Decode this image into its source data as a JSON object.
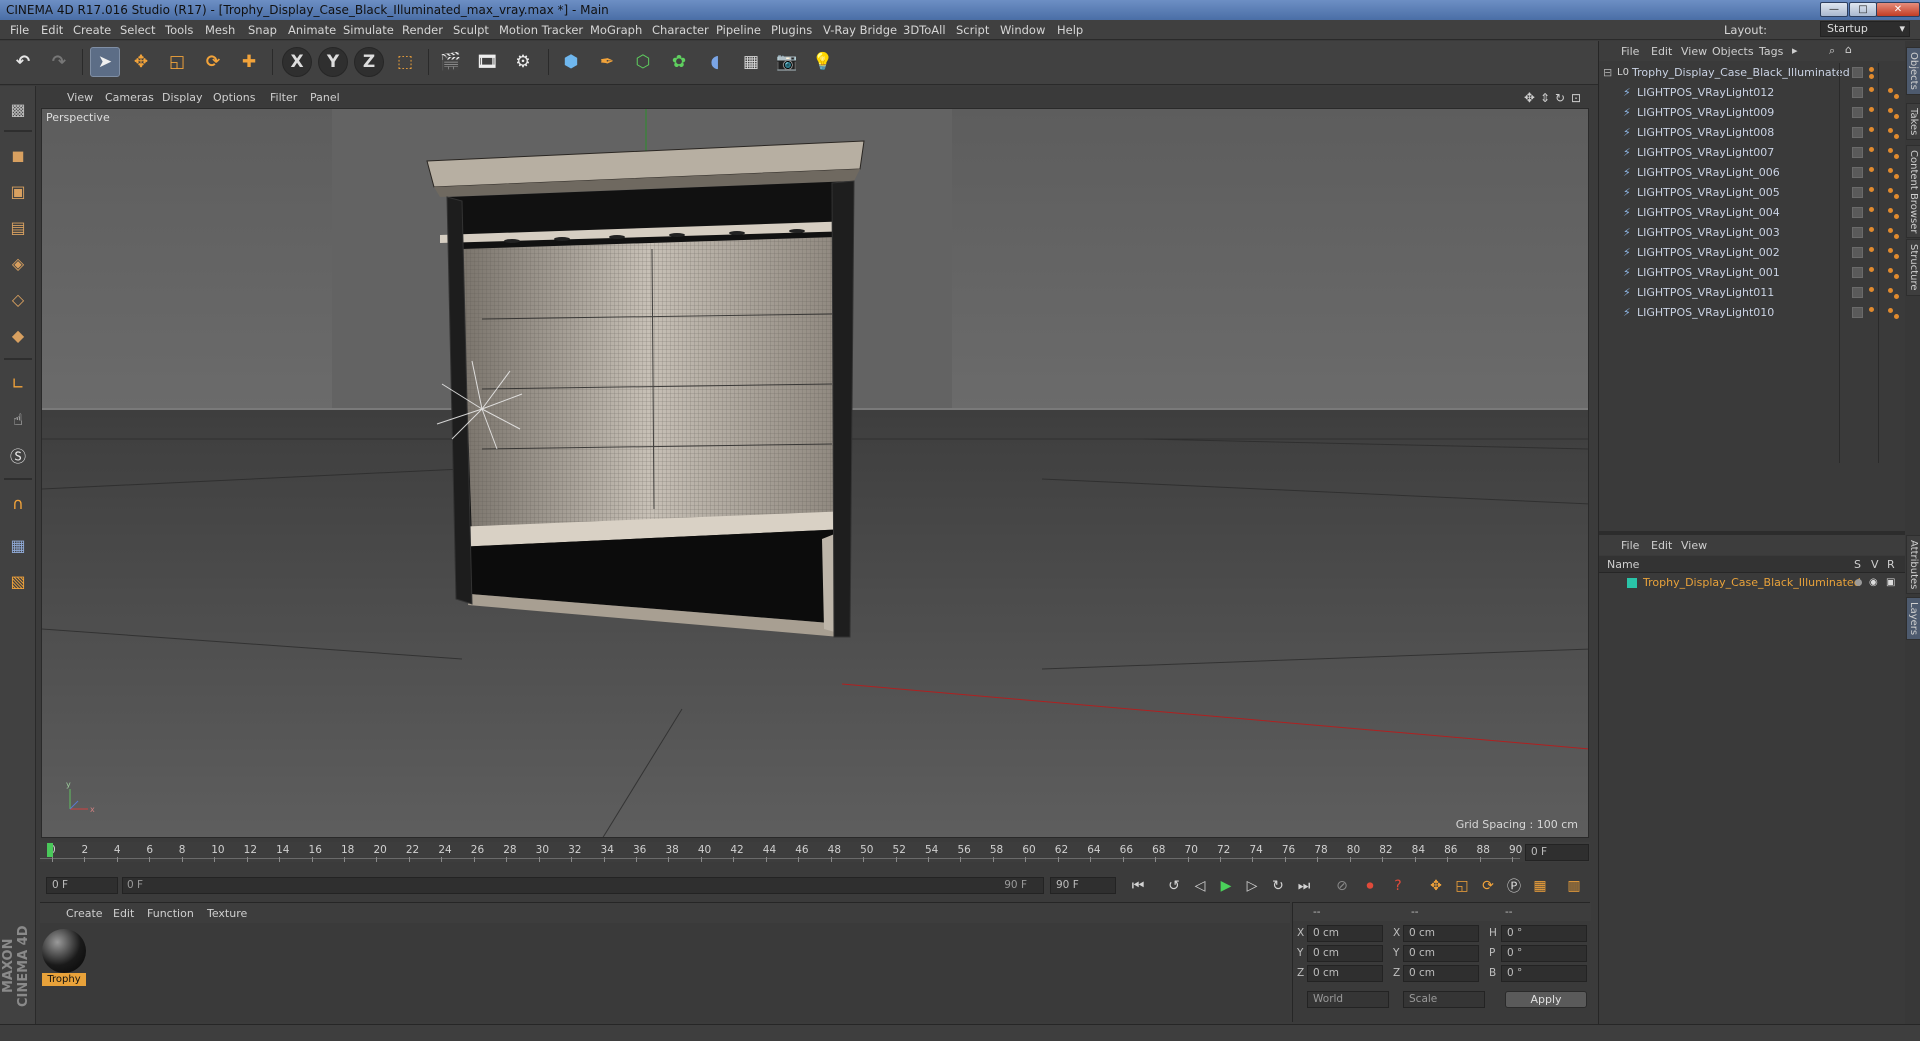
{
  "window": {
    "title": "CINEMA 4D R17.016 Studio (R17) - [Trophy_Display_Case_Black_Illuminated_max_vray.max *] - Main",
    "minimize": "—",
    "maximize": "□",
    "close": "✕"
  },
  "menubar": {
    "items": [
      "File",
      "Edit",
      "Create",
      "Select",
      "Tools",
      "Mesh",
      "Snap",
      "Animate",
      "Simulate",
      "Render",
      "Sculpt",
      "Motion Tracker",
      "MoGraph",
      "Character",
      "Pipeline",
      "Plugins",
      "V-Ray Bridge",
      "3DToAll",
      "Script",
      "Window",
      "Help"
    ],
    "layout_label": "Layout:",
    "layout_value": "Startup"
  },
  "toolbar": {
    "axis_x": "X",
    "axis_y": "Y",
    "axis_z": "Z"
  },
  "viewport": {
    "menu": [
      "View",
      "Cameras",
      "Display",
      "Options",
      "Filter",
      "Panel"
    ],
    "label": "Perspective",
    "grid_spacing": "Grid Spacing : 100 cm"
  },
  "object_manager": {
    "menu": [
      "File",
      "Edit",
      "View",
      "Objects",
      "Tags"
    ],
    "root": "Trophy_Display_Case_Black_Illuminated",
    "children": [
      "LIGHTPOS_VRayLight012",
      "LIGHTPOS_VRayLight009",
      "LIGHTPOS_VRayLight008",
      "LIGHTPOS_VRayLight007",
      "LIGHTPOS_VRayLight_006",
      "LIGHTPOS_VRayLight_005",
      "LIGHTPOS_VRayLight_004",
      "LIGHTPOS_VRayLight_003",
      "LIGHTPOS_VRayLight_002",
      "LIGHTPOS_VRayLight_001",
      "LIGHTPOS_VRayLight011",
      "LIGHTPOS_VRayLight010"
    ]
  },
  "layer_manager": {
    "menu": [
      "File",
      "Edit",
      "View"
    ],
    "col_name": "Name",
    "col_s": "S",
    "col_v": "V",
    "col_r": "R",
    "row": "Trophy_Display_Case_Black_Illuminated"
  },
  "side_tabs": {
    "top": [
      "Objects",
      "Takes",
      "Content Browser",
      "Structure"
    ],
    "bottom": [
      "Attributes",
      "Layers"
    ]
  },
  "timeline": {
    "ticks": [
      "0",
      "2",
      "4",
      "6",
      "8",
      "10",
      "12",
      "14",
      "16",
      "18",
      "20",
      "22",
      "24",
      "26",
      "28",
      "30",
      "32",
      "34",
      "36",
      "38",
      "40",
      "42",
      "44",
      "46",
      "48",
      "50",
      "52",
      "54",
      "56",
      "58",
      "60",
      "62",
      "64",
      "66",
      "68",
      "70",
      "72",
      "74",
      "76",
      "78",
      "80",
      "82",
      "84",
      "86",
      "88",
      "90"
    ],
    "current_frame": "0 F"
  },
  "transport": {
    "start": "0 F",
    "range_start": "0 F",
    "range_end": "90 F",
    "end": "90 F"
  },
  "materials": {
    "menu": [
      "Create",
      "Edit",
      "Function",
      "Texture"
    ],
    "items": [
      {
        "name": "Trophy"
      }
    ]
  },
  "coordinates": {
    "header": [
      "--",
      "--",
      "--"
    ],
    "rows": [
      {
        "a": "X",
        "av": "0 cm",
        "b": "X",
        "bv": "0 cm",
        "c": "H",
        "cv": "0 °"
      },
      {
        "a": "Y",
        "av": "0 cm",
        "b": "Y",
        "bv": "0 cm",
        "c": "P",
        "cv": "0 °"
      },
      {
        "a": "Z",
        "av": "0 cm",
        "b": "Z",
        "bv": "0 cm",
        "c": "B",
        "cv": "0 °"
      }
    ],
    "mode1": "World",
    "mode2": "Scale",
    "apply": "Apply"
  },
  "branding": "MAXON CINEMA 4D",
  "colors": {
    "accent_orange": "#e08a2e",
    "selection_blue": "#5c6d86",
    "viewport_bg": "#595959"
  }
}
